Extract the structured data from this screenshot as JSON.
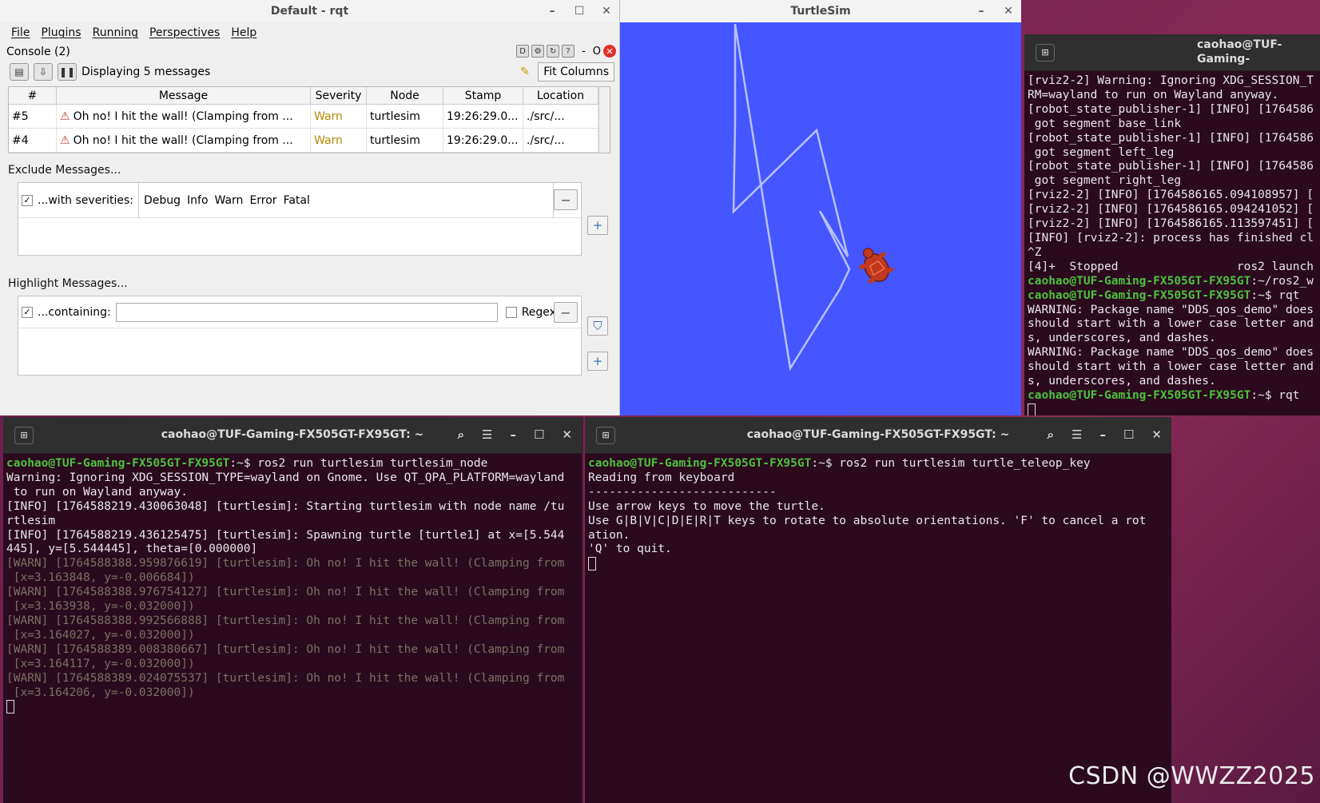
{
  "rqt": {
    "title": "Default - rqt",
    "menu": [
      "File",
      "Plugins",
      "Running",
      "Perspectives",
      "Help"
    ],
    "console_label": "Console (2)",
    "console_tools": [
      "D",
      "-",
      "O"
    ],
    "displaying": "Displaying 5 messages",
    "fit_columns": "Fit Columns",
    "columns": [
      "#",
      "Message",
      "Severity",
      "Node",
      "Stamp",
      "Location"
    ],
    "rows": [
      {
        "id": "#5",
        "message": "Oh no! I hit the wall! (Clamping from ...",
        "severity": "Warn",
        "node": "turtlesim",
        "stamp": "19:26:29.0...",
        "location": "./src/..."
      },
      {
        "id": "#4",
        "message": "Oh no! I hit the wall! (Clamping from ...",
        "severity": "Warn",
        "node": "turtlesim",
        "stamp": "19:26:29.0...",
        "location": "./src/..."
      }
    ],
    "exclude_label": "Exclude Messages...",
    "severities_label": "...with severities:",
    "severities": [
      "Debug",
      "Info",
      "Warn",
      "Error",
      "Fatal"
    ],
    "highlight_label": "Highlight Messages...",
    "containing_label": "...containing:",
    "regex_label": "Regex"
  },
  "turtlesim": {
    "title": "TurtleSim",
    "bg_color": "#4555ff",
    "path_color": "#b8c0ff"
  },
  "term_node": {
    "title": "caohao@TUF-Gaming-FX505GT-FX95GT: ~",
    "prompt": "caohao@TUF-Gaming-FX505GT-FX95GT",
    "command": ":~$ ros2 run turtlesim turtlesim_node",
    "lines": [
      "Warning: Ignoring XDG_SESSION_TYPE=wayland on Gnome. Use QT_QPA_PLATFORM=wayland",
      " to run on Wayland anyway.",
      "[INFO] [1764588219.430063048] [turtlesim]: Starting turtlesim with node name /tu",
      "rtlesim",
      "[INFO] [1764588219.436125475] [turtlesim]: Spawning turtle [turtle1] at x=[5.544",
      "445], y=[5.544445], theta=[0.000000]"
    ],
    "warn_lines": [
      "[WARN] [1764588388.959876619] [turtlesim]: Oh no! I hit the wall! (Clamping from",
      " [x=3.163848, y=-0.006684])",
      "[WARN] [1764588388.976754127] [turtlesim]: Oh no! I hit the wall! (Clamping from",
      " [x=3.163938, y=-0.032000])",
      "[WARN] [1764588388.992566888] [turtlesim]: Oh no! I hit the wall! (Clamping from",
      " [x=3.164027, y=-0.032000])",
      "[WARN] [1764588389.008380667] [turtlesim]: Oh no! I hit the wall! (Clamping from",
      " [x=3.164117, y=-0.032000])",
      "[WARN] [1764588389.024075537] [turtlesim]: Oh no! I hit the wall! (Clamping from",
      " [x=3.164206, y=-0.032000])"
    ]
  },
  "term_teleop": {
    "title": "caohao@TUF-Gaming-FX505GT-FX95GT: ~",
    "prompt": "caohao@TUF-Gaming-FX505GT-FX95GT",
    "command": ":~$ ros2 run turtlesim turtle_teleop_key",
    "lines": [
      "Reading from keyboard",
      "---------------------------",
      "Use arrow keys to move the turtle.",
      "Use G|B|V|C|D|E|R|T keys to rotate to absolute orientations. 'F' to cancel a rot",
      "ation.",
      "'Q' to quit."
    ]
  },
  "term_rviz": {
    "title": "caohao@TUF-Gaming-",
    "lines_a": [
      "[rviz2-2] Warning: Ignoring XDG_SESSION_T",
      "RM=wayland to run on Wayland anyway.",
      "[robot_state_publisher-1] [INFO] [1764586",
      " got segment base_link",
      "[robot_state_publisher-1] [INFO] [1764586",
      " got segment left_leg",
      "[robot_state_publisher-1] [INFO] [1764586",
      " got segment right_leg",
      "[rviz2-2] [INFO] [1764586165.094108957] [",
      "[rviz2-2] [INFO] [1764586165.094241052] [",
      "[rviz2-2] [INFO] [1764586165.113597451] [",
      "[INFO] [rviz2-2]: process has finished cl",
      "^Z",
      "[4]+  Stopped                 ros2 launch"
    ],
    "prompt1": "caohao@TUF-Gaming-FX505GT-FX95GT",
    "prompt1_rest": ":~/ros2_w",
    "prompt2": "caohao@TUF-Gaming-FX505GT-FX95GT",
    "prompt2_rest": ":~$ rqt",
    "lines_b": [
      "WARNING: Package name \"DDS_qos_demo\" does",
      "should start with a lower case letter and",
      "s, underscores, and dashes.",
      "WARNING: Package name \"DDS_qos_demo\" does",
      "should start with a lower case letter and",
      "s, underscores, and dashes."
    ],
    "prompt3": "caohao@TUF-Gaming-FX505GT-FX95GT",
    "prompt3_rest": ":~$ rqt"
  },
  "watermark": "CSDN @WWZZ2025"
}
